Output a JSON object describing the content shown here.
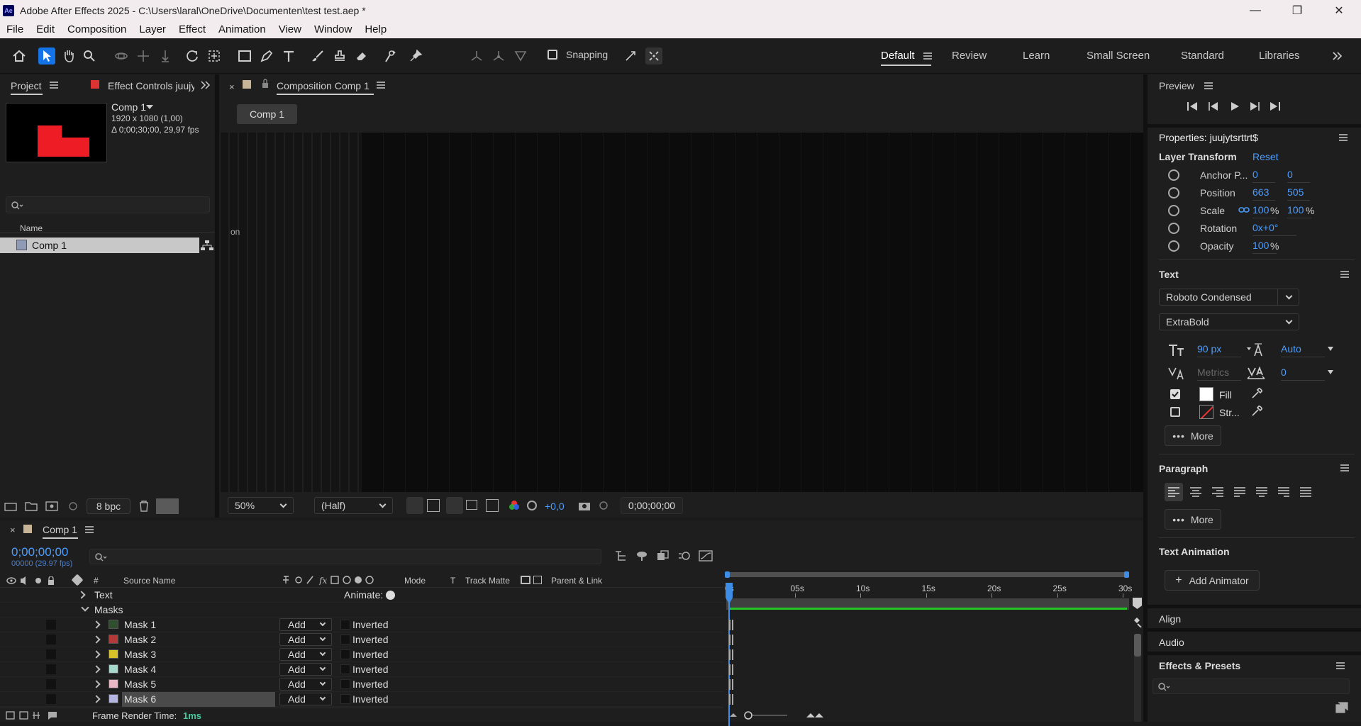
{
  "window": {
    "title": "Adobe After Effects 2025 - C:\\Users\\laral\\OneDrive\\Documenten\\test test.aep *",
    "logo": "Ae",
    "minimize": "—",
    "maximize": "❐",
    "close": "✕"
  },
  "menu": [
    "File",
    "Edit",
    "Composition",
    "Layer",
    "Effect",
    "Animation",
    "View",
    "Window",
    "Help"
  ],
  "toolbar": {
    "snapping": "Snapping"
  },
  "workspaces": [
    "Default",
    "Review",
    "Learn",
    "Small Screen",
    "Standard",
    "Libraries"
  ],
  "project": {
    "tab_project": "Project",
    "tab_effect_controls": "Effect Controls juujyt",
    "comp_name": "Comp 1",
    "comp_size": "1920 x 1080 (1,00)",
    "comp_duration": "Δ 0;00;30;00, 29,97 fps",
    "col_name": "Name",
    "item": "Comp 1",
    "bpc": "8 bpc",
    "col_partial": "on"
  },
  "composition": {
    "tab": "Composition Comp 1",
    "breadcrumb": "Comp 1",
    "zoom": "50%",
    "resolution": "(Half)",
    "exposure": "+0,0",
    "timecode": "0;00;00;00"
  },
  "timeline": {
    "tab": "Comp 1",
    "timecode": "0;00;00;00",
    "frames": "00000 (29.97 fps)",
    "cols": {
      "num": "#",
      "source": "Source Name",
      "mode": "Mode",
      "t": "T",
      "track": "Track Matte",
      "parent": "Parent & Link"
    },
    "text_group": "Text",
    "animate": "Animate:",
    "masks_group": "Masks",
    "masks": [
      {
        "name": "Mask 1",
        "mode": "Add",
        "inverted": "Inverted",
        "color": "#2f4f2f"
      },
      {
        "name": "Mask 2",
        "mode": "Add",
        "inverted": "Inverted",
        "color": "#b43a3a"
      },
      {
        "name": "Mask 3",
        "mode": "Add",
        "inverted": "Inverted",
        "color": "#d8c22a"
      },
      {
        "name": "Mask 4",
        "mode": "Add",
        "inverted": "Inverted",
        "color": "#a8d8cc"
      },
      {
        "name": "Mask 5",
        "mode": "Add",
        "inverted": "Inverted",
        "color": "#e8b8c4"
      },
      {
        "name": "Mask 6",
        "mode": "Add",
        "inverted": "Inverted",
        "color": "#b4b4e0"
      }
    ],
    "ruler": [
      "0s",
      "05s",
      "10s",
      "15s",
      "20s",
      "25s",
      "30s"
    ],
    "render_label": "Frame Render Time:",
    "render_value": "1ms"
  },
  "preview": {
    "title": "Preview"
  },
  "properties": {
    "title": "Properties: juujytsrttrt$",
    "layer_transform": "Layer Transform",
    "reset": "Reset",
    "anchor": {
      "label": "Anchor P...",
      "x": "0",
      "y": "0"
    },
    "position": {
      "label": "Position",
      "x": "663",
      "y": "505"
    },
    "scale": {
      "label": "Scale",
      "x": "100",
      "y": "100",
      "pct": "%"
    },
    "rotation": {
      "label": "Rotation",
      "value": "0x+0°"
    },
    "opacity": {
      "label": "Opacity",
      "value": "100",
      "pct": "%"
    },
    "text_title": "Text",
    "font": "Roboto Condensed",
    "style": "ExtraBold",
    "size": "90 px",
    "leading": "Auto",
    "kerning": "Metrics",
    "tracking": "0",
    "fill": "Fill",
    "stroke": "Str...",
    "more": "More",
    "paragraph": "Paragraph",
    "text_animation": "Text Animation",
    "add_animator": "Add Animator",
    "align": "Align",
    "audio": "Audio",
    "effects_presets": "Effects & Presets"
  }
}
